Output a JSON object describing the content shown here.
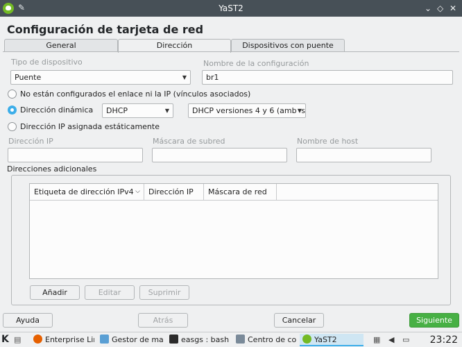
{
  "window": {
    "title": "YaST2"
  },
  "dialog_title": "Configuración de tarjeta de red",
  "tabs": [
    {
      "label": "General",
      "active": false
    },
    {
      "label": "Dirección",
      "active": true
    },
    {
      "label": "Dispositivos con puente",
      "active": false
    }
  ],
  "device_type": {
    "label": "Tipo de dispositivo",
    "value": "Puente"
  },
  "config_name": {
    "label": "Nombre de la configuración",
    "value": "br1"
  },
  "addressing": {
    "no_link": {
      "label": "No están configurados el enlace ni la IP (vínculos asociados)",
      "checked": false
    },
    "dynamic": {
      "label": "Dirección dinámica",
      "checked": true,
      "mode": "DHCP",
      "versions": "DHCP versiones 4 y 6 (ambas"
    },
    "static": {
      "label": "Dirección IP asignada estáticamente",
      "checked": false
    }
  },
  "static_fields": {
    "ip": {
      "label": "Dirección IP",
      "value": ""
    },
    "mask": {
      "label": "Máscara de subred",
      "value": ""
    },
    "host": {
      "label": "Nombre de host",
      "value": ""
    }
  },
  "additional": {
    "label": "Direcciones adicionales",
    "columns": [
      "Etiqueta de dirección IPv4",
      "Dirección IP",
      "Máscara de red"
    ],
    "add_button": "Añadir",
    "edit_button": "Editar",
    "delete_button": "Suprimir"
  },
  "footer": {
    "help": "Ayuda",
    "back": "Atrás",
    "cancel": "Cancelar",
    "next": "Siguiente"
  },
  "taskbar": {
    "items": [
      {
        "label": "Enterprise Lin",
        "icon": "firefox-icon",
        "color": "#e66000"
      },
      {
        "label": "Gestor de ma",
        "icon": "file-manager-icon",
        "color": "#5a9fd4"
      },
      {
        "label": "easgs : bash",
        "icon": "terminal-icon",
        "color": "#2b2b2b"
      },
      {
        "label": "Centro de co",
        "icon": "control-center-icon",
        "color": "#7a8a99"
      },
      {
        "label": "YaST2",
        "icon": "yast-icon",
        "color": "#73ba25"
      }
    ],
    "clock": "23:22"
  },
  "colors": {
    "accent": "#3daee9",
    "primary_button": "#47b044",
    "titlebar": "#475057"
  }
}
